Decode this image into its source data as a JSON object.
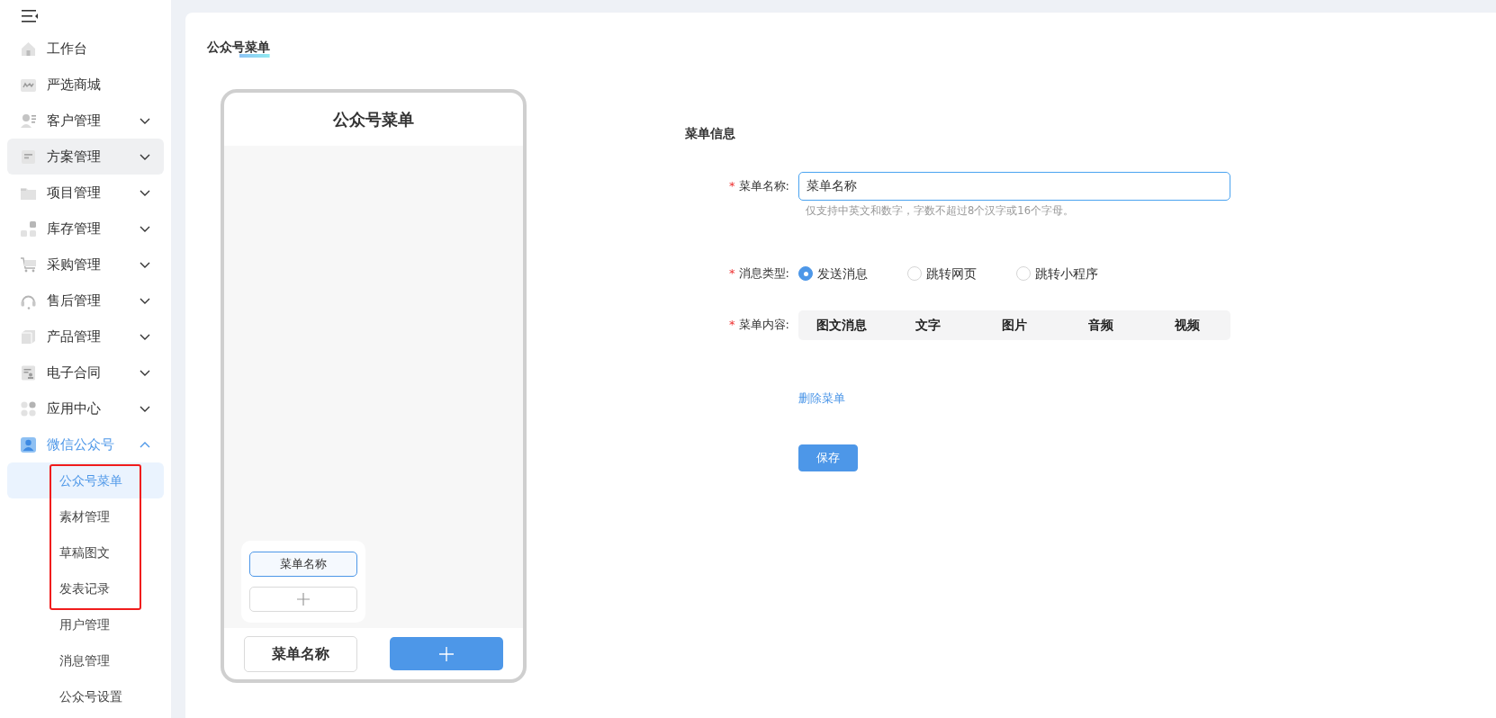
{
  "sidebar": {
    "items": [
      {
        "label": "工作台"
      },
      {
        "label": "严选商城"
      },
      {
        "label": "客户管理",
        "expanded": false
      },
      {
        "label": "方案管理",
        "expanded": false,
        "hovered": true
      },
      {
        "label": "项目管理",
        "expanded": false
      },
      {
        "label": "库存管理",
        "expanded": false
      },
      {
        "label": "采购管理",
        "expanded": false
      },
      {
        "label": "售后管理",
        "expanded": false
      },
      {
        "label": "产品管理",
        "expanded": false
      },
      {
        "label": "电子合同",
        "expanded": false
      },
      {
        "label": "应用中心",
        "expanded": false
      },
      {
        "label": "微信公众号",
        "expanded": true,
        "children": [
          {
            "label": "公众号菜单",
            "selected": true,
            "highlighted": true
          },
          {
            "label": "素材管理",
            "selected": false,
            "highlighted": true
          },
          {
            "label": "草稿图文",
            "selected": false,
            "highlighted": true
          },
          {
            "label": "发表记录",
            "selected": false,
            "highlighted": true
          },
          {
            "label": "用户管理",
            "selected": false,
            "highlighted": false
          },
          {
            "label": "消息管理",
            "selected": false,
            "highlighted": false
          },
          {
            "label": "公众号设置",
            "selected": false,
            "highlighted": false
          }
        ]
      }
    ]
  },
  "page": {
    "title": "公众号菜单"
  },
  "phone": {
    "title": "公众号菜单",
    "submenu": [
      {
        "label": "菜单名称",
        "selected": true
      }
    ],
    "menus": [
      {
        "label": "菜单名称",
        "selected": false
      }
    ]
  },
  "form": {
    "title": "菜单信息",
    "name": {
      "label": "菜单名称:",
      "required_mark": "*",
      "value": "菜单名称",
      "hint": "仅支持中英文和数字，字数不超过8个汉字或16个字母。"
    },
    "type": {
      "label": "消息类型:",
      "required_mark": "*",
      "options": [
        {
          "label": "发送消息",
          "selected": true
        },
        {
          "label": "跳转网页",
          "selected": false
        },
        {
          "label": "跳转小程序",
          "selected": false
        }
      ]
    },
    "content": {
      "label": "菜单内容:",
      "required_mark": "*",
      "tabs": [
        "图文消息",
        "文字",
        "图片",
        "音频",
        "视频"
      ]
    },
    "delete_link": "删除菜单",
    "save_button": "保存"
  }
}
